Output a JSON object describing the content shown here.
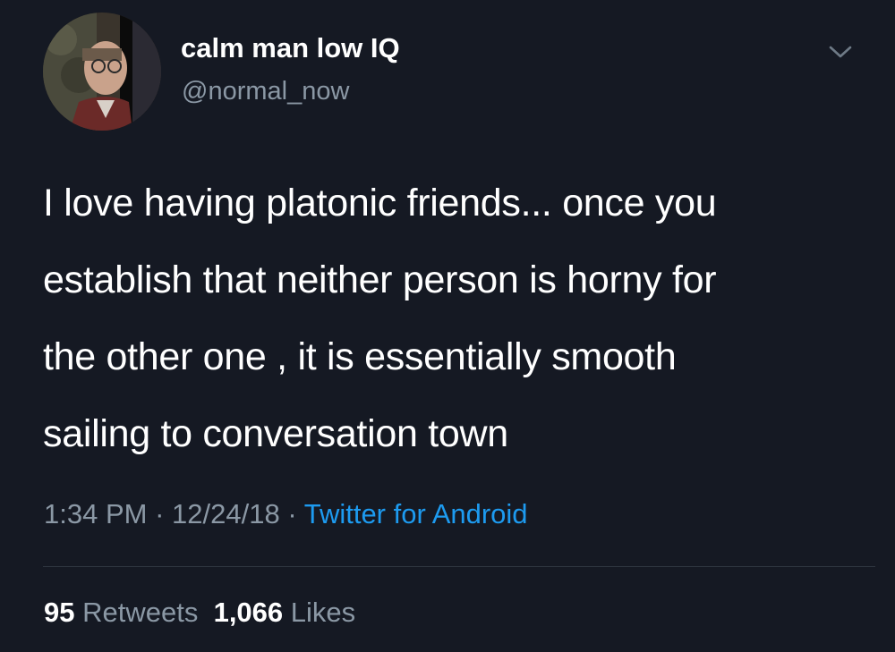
{
  "author": {
    "display_name": "calm man low IQ",
    "handle": "@normal_now"
  },
  "tweet": {
    "text_lines": [
      "I love having platonic friends... once you",
      "establish that neither person is horny for",
      "the other one , it is essentially smooth",
      "sailing to conversation town"
    ],
    "time": "1:34 PM",
    "date": "12/24/18",
    "separator": "·",
    "source": "Twitter for Android"
  },
  "stats": {
    "retweets_count": "95",
    "retweets_label": "Retweets",
    "likes_count": "1,066",
    "likes_label": "Likes"
  },
  "icons": {
    "menu": "chevron-down-icon",
    "avatar": "avatar"
  },
  "colors": {
    "background": "#151923",
    "primary_text": "#ffffff",
    "secondary_text": "#8b98a5",
    "link": "#1d9bf0"
  }
}
